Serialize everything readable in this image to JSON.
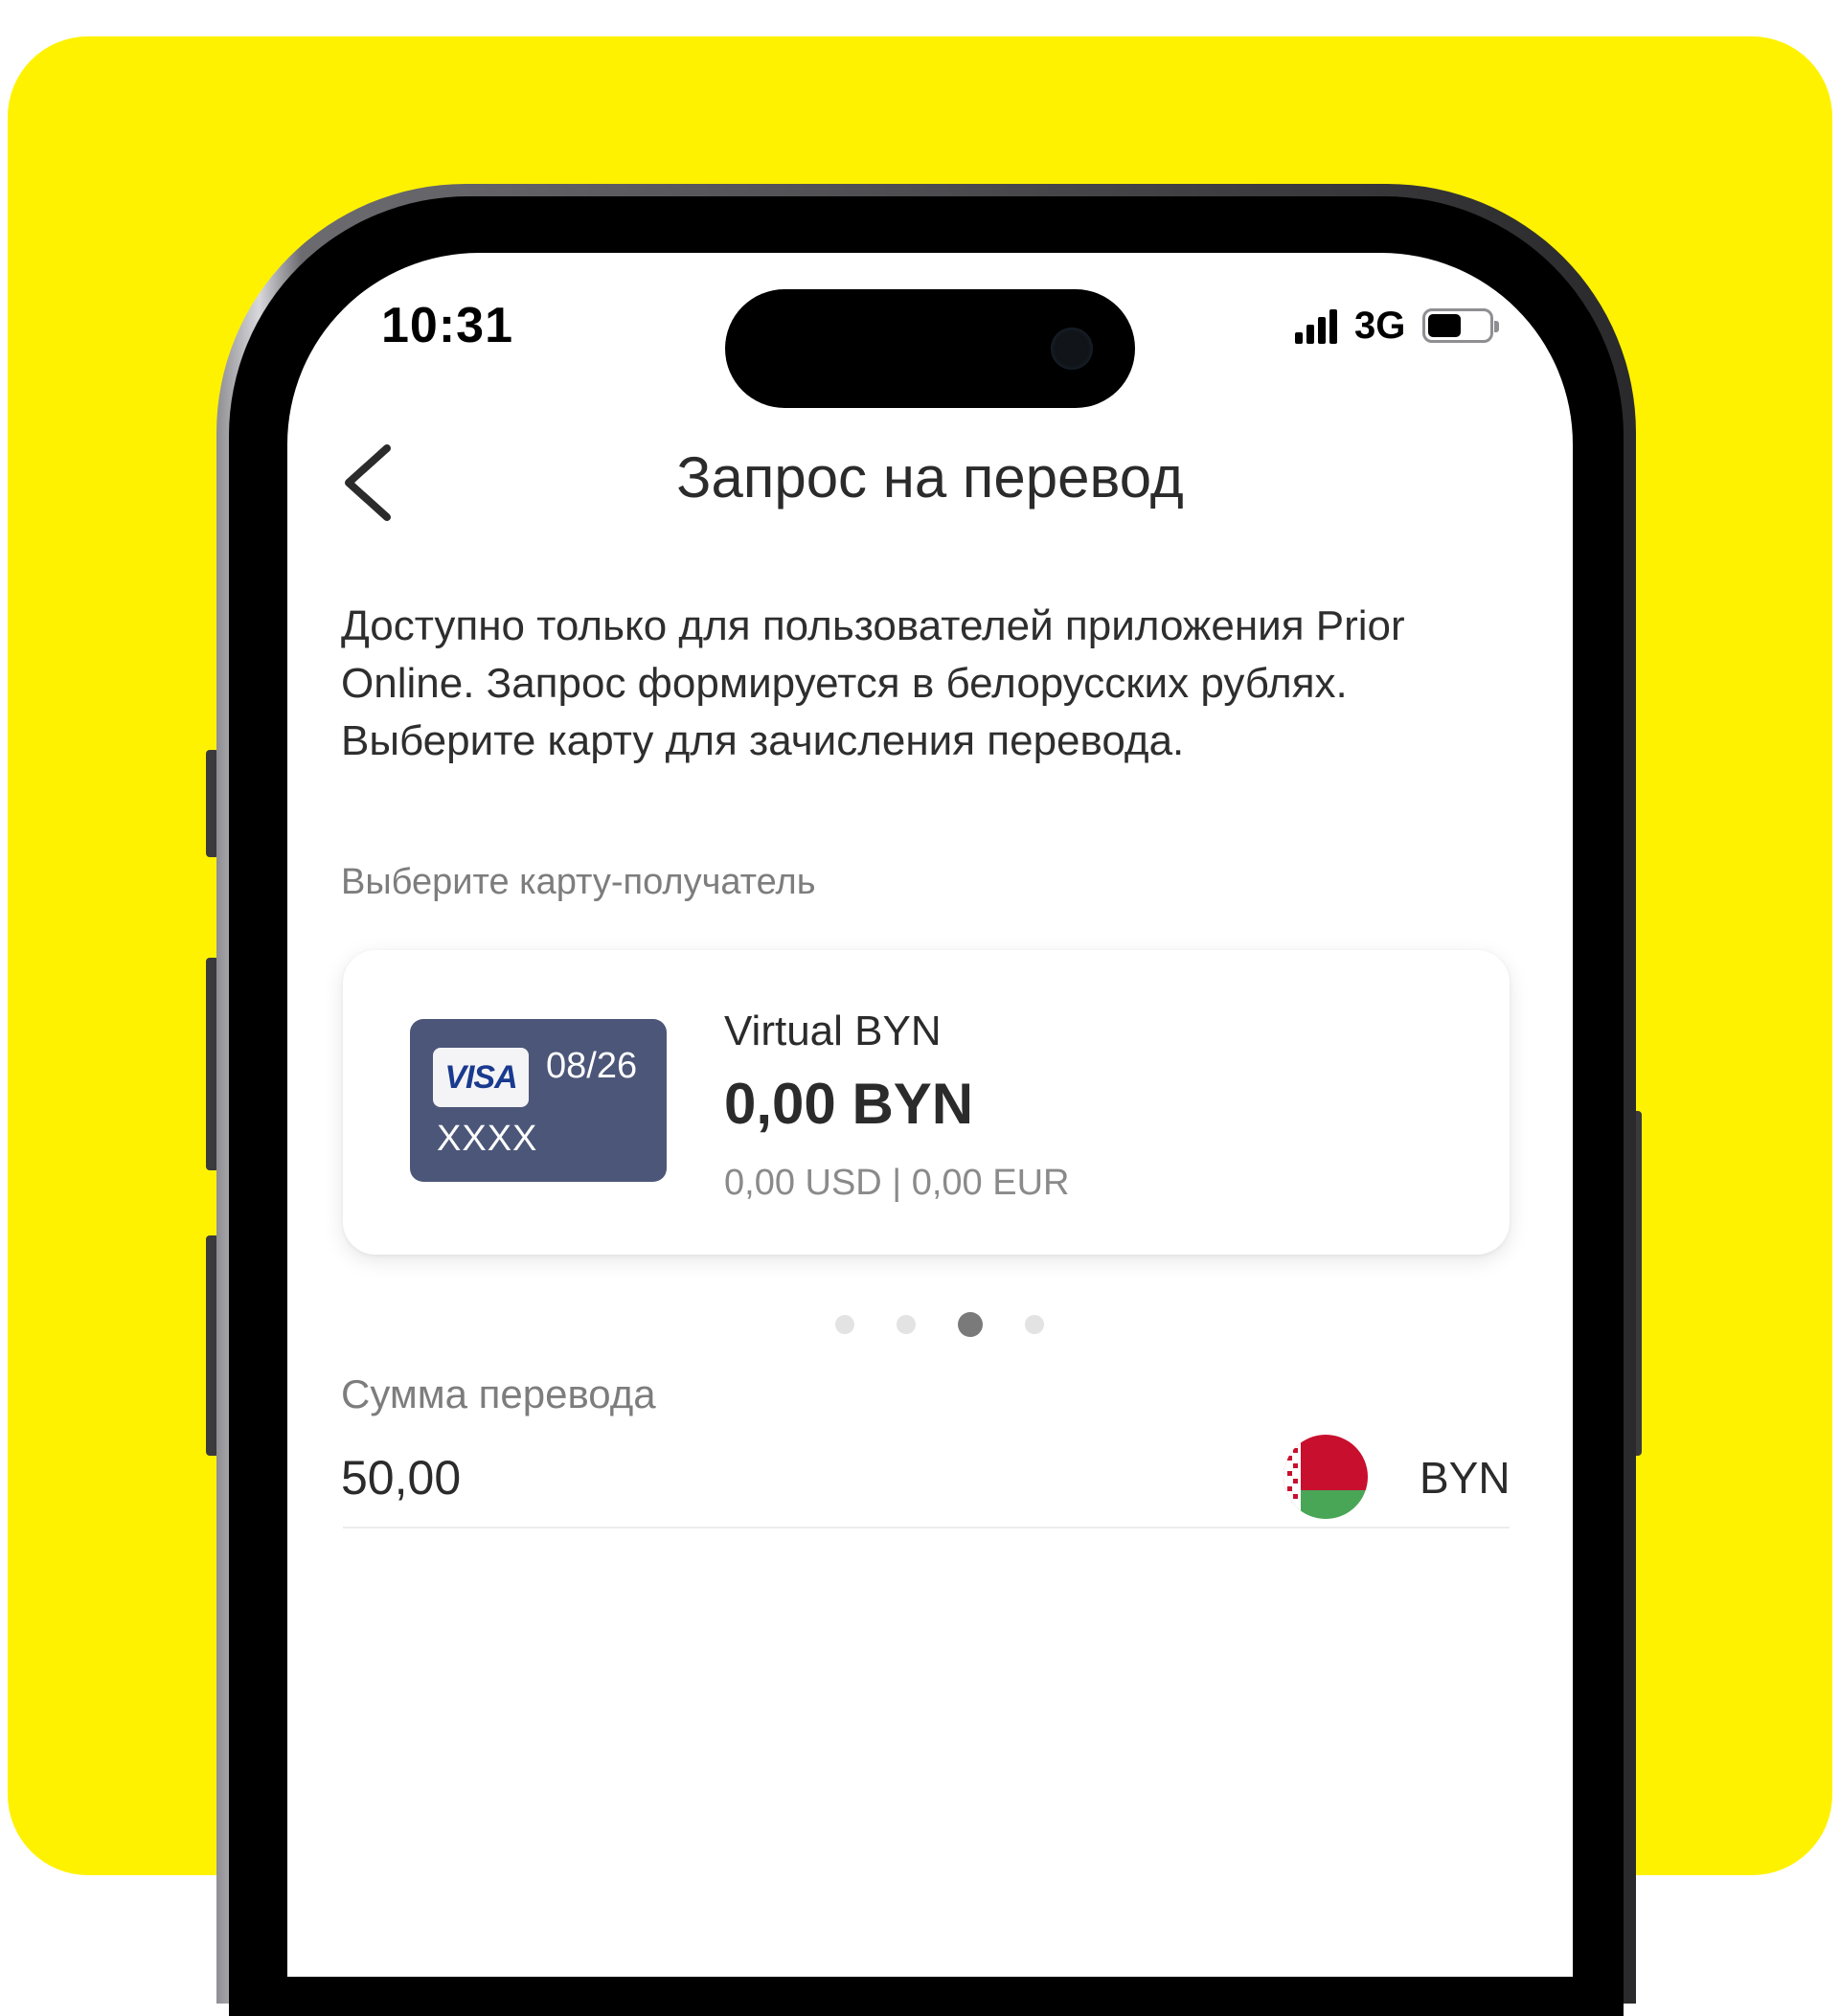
{
  "status_bar": {
    "time": "10:31",
    "network": "3G",
    "battery_level": 0.55
  },
  "header": {
    "title": "Запрос на перевод",
    "back_icon": "chevron-left-icon"
  },
  "description": {
    "lines": [
      "Доступно только для пользователей приложения Prior Online. Запрос формируется в белорусских рублях.",
      "Выберите карту для зачисления перевода."
    ]
  },
  "card_section": {
    "label": "Выберите карту-получатель",
    "card": {
      "brand": "VISA",
      "expiry": "08/26",
      "masked_number": "XXXX",
      "name": "Virtual BYN",
      "balance": "0,00 BYN",
      "secondary_balances": "0,00 USD | 0,00 EUR",
      "thumb_color": "#4C5679"
    },
    "pager": {
      "count": 4,
      "active_index": 2
    }
  },
  "amount": {
    "label": "Сумма перевода",
    "value": "50,00",
    "currency": "BYN",
    "currency_flag": "belarus-flag-icon"
  },
  "colors": {
    "background_accent": "#FFF200",
    "text_primary": "#2B2B2B",
    "text_secondary": "#7D7D7D",
    "flag_red": "#C8102E",
    "flag_green": "#4AA657"
  }
}
